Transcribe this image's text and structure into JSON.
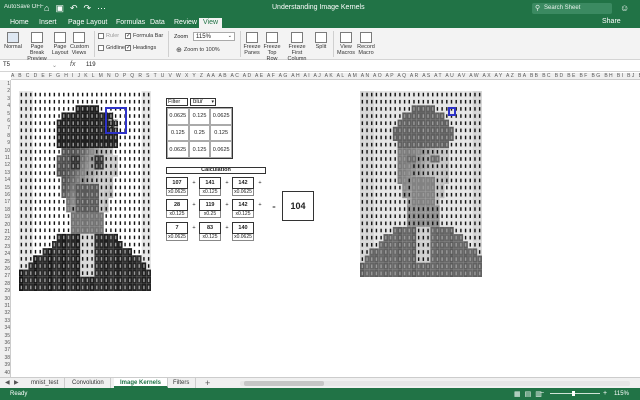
{
  "titlebar": {
    "autosave": "AutoSave OFF",
    "title": "Understanding Image Kernels",
    "search_placeholder": "Search Sheet"
  },
  "tabs": [
    "Home",
    "Insert",
    "Page Layout",
    "Formulas",
    "Data",
    "Review",
    "View"
  ],
  "active_tab": "View",
  "share_label": "Share",
  "ribbon": {
    "normal": "Normal",
    "page_break_preview": "Page Break Preview",
    "page_layout": "Page Layout",
    "custom_views": "Custom Views",
    "ruler": "Ruler",
    "gridlines": "Gridlines",
    "formula_bar": "Formula Bar",
    "headings": "Headings",
    "zoom_label": "Zoom",
    "zoom_value": "115%",
    "zoom_to_100": "Zoom to 100%",
    "freeze_panes": "Freeze Panes",
    "freeze_top_row": "Freeze Top Row",
    "freeze_first_column": "Freeze First Column",
    "split": "Split",
    "view_macros": "View Macros",
    "record_macro": "Record Macro"
  },
  "formula_bar": {
    "name_box": "T5",
    "fx": "fx",
    "value": "119"
  },
  "column_headers": "A B C D E F G H I J K L M N O P Q R S T U V W X Y Z AA AB AC AD AE AF AG AH AI AJ AK AL AM AN AO AP AQ AR AS AT AU AV AW AX AY AZ BA BB BC BD BE BF BG BH BI BJ BK BL BM BN BO BP BQ BR BS BT BU BV BW BX BY BZ CA CB CC CD CE CF CG CH CI CJ CK CL CM CN CO CP CQ CR CS CT CU CV CW CX CY CZ DA",
  "row_headers": [
    "1",
    "2",
    "3",
    "4",
    "5",
    "6",
    "7",
    "8",
    "9",
    "10",
    "11",
    "12",
    "13",
    "14",
    "15",
    "16",
    "17",
    "18",
    "19",
    "20",
    "21",
    "22",
    "23",
    "24",
    "25",
    "26",
    "27",
    "28",
    "29",
    "30",
    "31",
    "32",
    "33",
    "34",
    "35",
    "36",
    "37",
    "38",
    "39",
    "40"
  ],
  "kernel_window_values": [
    "107",
    "141",
    "142",
    "28",
    "119",
    "142",
    "7",
    "83",
    "140"
  ],
  "filter": {
    "label": "Filter",
    "selected": "blur",
    "values": [
      "0.0625",
      "0.125",
      "0.0625",
      "0.125",
      "0.25",
      "0.125",
      "0.0625",
      "0.125",
      "0.0625"
    ]
  },
  "calculation": {
    "title": "Calculation",
    "cells": [
      {
        "value": "107",
        "weight": "x0.0625"
      },
      {
        "value": "141",
        "weight": "x0.125"
      },
      {
        "value": "142",
        "weight": "x0.0625"
      },
      {
        "value": "28",
        "weight": "x0.125"
      },
      {
        "value": "119",
        "weight": "x0.25"
      },
      {
        "value": "142",
        "weight": "x0.125"
      },
      {
        "value": "7",
        "weight": "x0.0625"
      },
      {
        "value": "83",
        "weight": "x0.125"
      },
      {
        "value": "140",
        "weight": "x0.0625"
      }
    ],
    "plus": "+",
    "equals": "=",
    "result": "104"
  },
  "sheet_tabs": [
    "mnist_test",
    "Convolution",
    "Image Kernels",
    "Filters"
  ],
  "active_sheet": "Image Kernels",
  "add_sheet": "+",
  "status": {
    "ready": "Ready",
    "zoom": "115%",
    "zoom_minus": "−",
    "zoom_plus": "+"
  },
  "colors": {
    "excel_green": "#217346",
    "highlight_blue": "#2d32c8"
  }
}
